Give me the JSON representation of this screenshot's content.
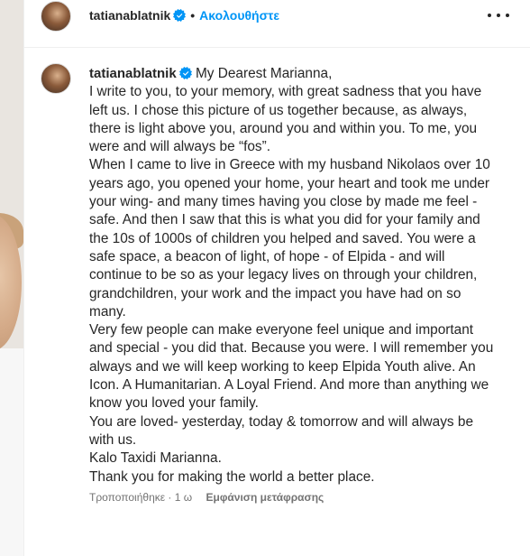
{
  "post": {
    "username": "tatianablatnik",
    "separator": "•",
    "follow_label": "Ακολουθήστε"
  },
  "caption": {
    "username": "tatianablatnik",
    "lines": [
      "My Dearest Marianna,",
      "I write to you, to your memory, with great sadness that you have left us. I chose this picture of us together because, as always, there is light above you, around you and within you. To me, you were and will always be “fos”.",
      "When I came to live in Greece with my husband Nikolaos over 10 years ago, you opened your home, your heart and took me under your wing- and many times having you close by made me feel - safe. And then I saw that this is what you did for your family and the 10s of 1000s of children you helped and saved. You were a safe space, a beacon of light, of hope - of Elpida - and will continue to be so as your legacy lives on through your children, grandchildren, your work and the impact you have had on so many.",
      "Very few people can make everyone feel unique and important and special - you did that. Because you were. I will remember you always and we will keep working to keep Elpida Youth alive. An Icon. A Humanitarian. A Loyal Friend. And more than anything we know you loved your family.",
      "You are loved- yesterday, today & tomorrow and will always be with us.",
      "Kalo Taxidi Marianna.",
      "Thank you for making the world a better place."
    ]
  },
  "meta": {
    "edited": "Τροποποιήθηκε · 1 ω",
    "translation_label": "Εμφάνιση μετάφρασης"
  },
  "colors": {
    "accent": "#0095f6",
    "verified": "#0095f6",
    "text": "#262626",
    "muted": "#737373",
    "border": "#efefef"
  },
  "icons": {
    "verified": "verified-badge-icon",
    "more": "more-options-icon"
  }
}
